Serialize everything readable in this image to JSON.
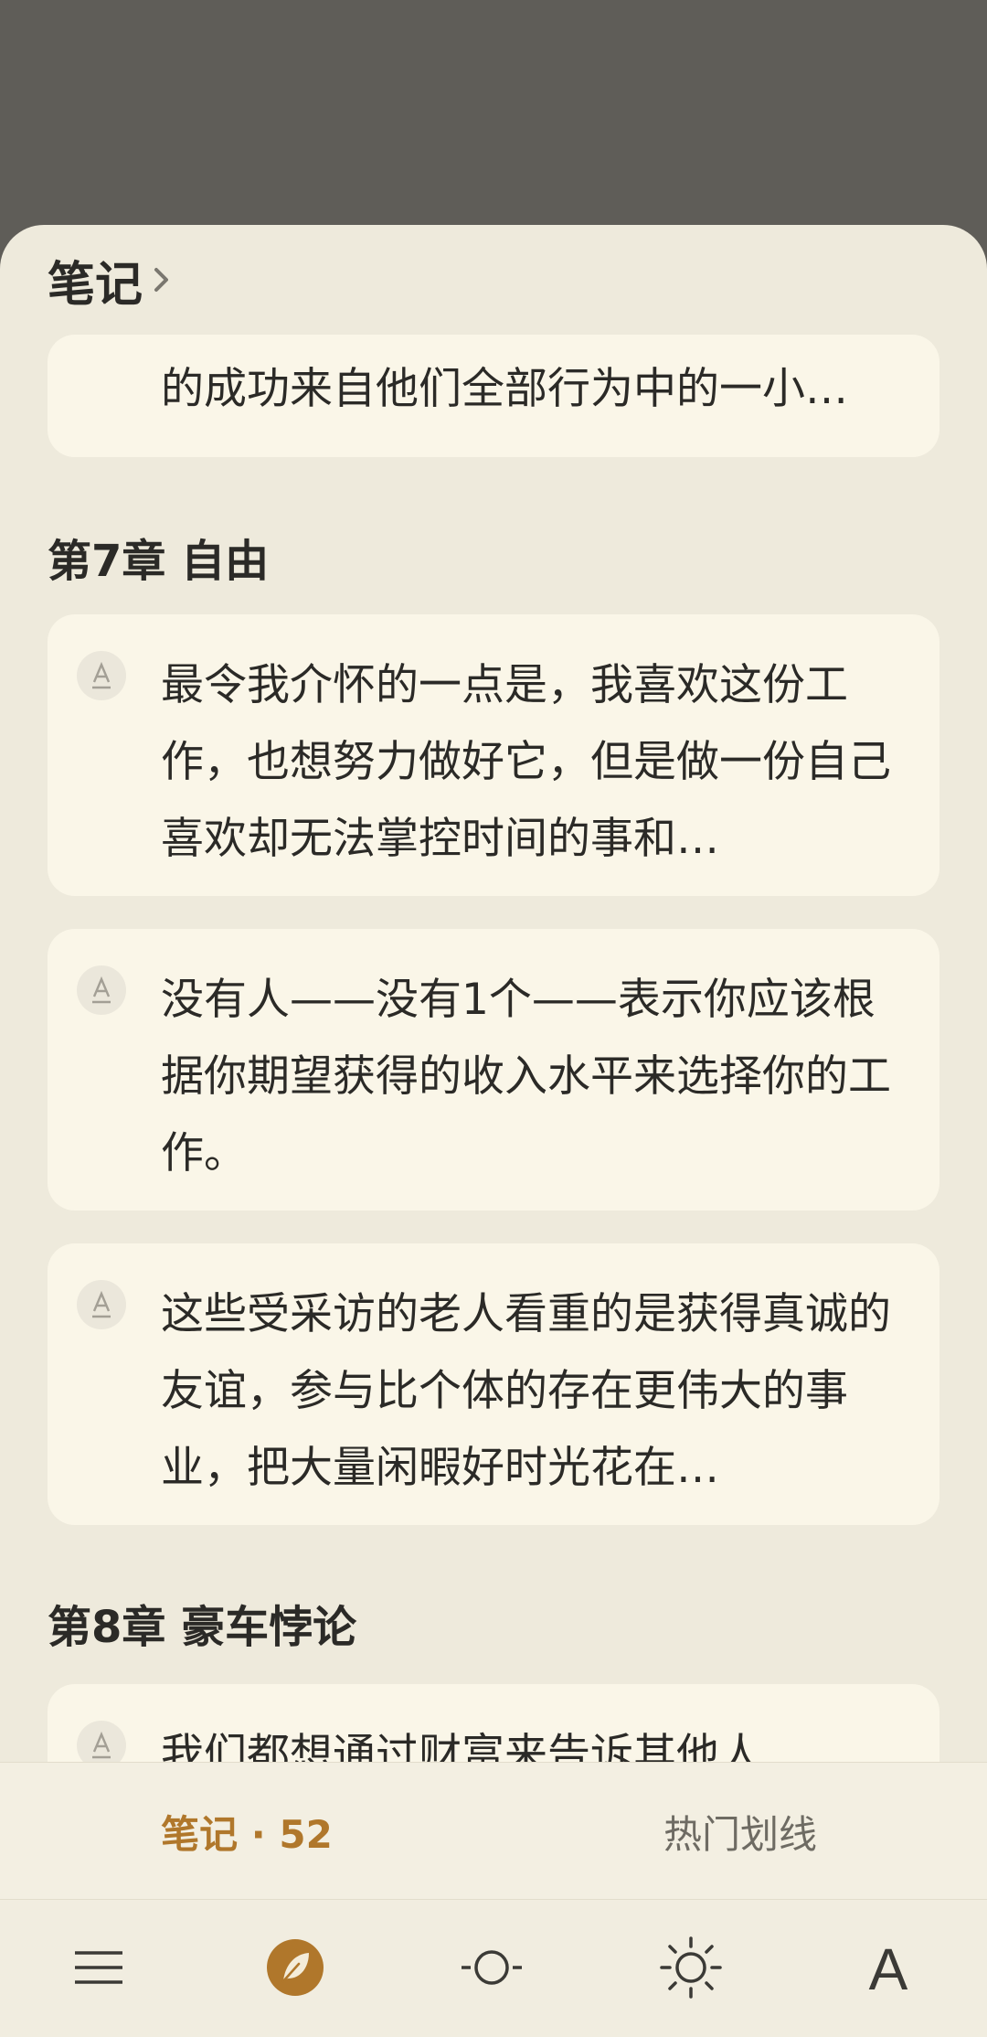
{
  "header": {
    "title": "笔记",
    "chevron_icon": "chevron-right-icon"
  },
  "top_card": {
    "text": "的成功来自他们全部行为中的一小…"
  },
  "chapters": [
    {
      "title": "第7章 自由",
      "notes": [
        {
          "text": "最令我介怀的一点是，我喜欢这份工作，也想努力做好它，但是做一份自己喜欢却无法掌控时间的事和…",
          "icon": "underline-a-icon"
        },
        {
          "text": "没有人——没有1个——表示你应该根据你期望获得的收入水平来选择你的工作。",
          "icon": "underline-a-icon"
        },
        {
          "text": "这些受采访的老人看重的是获得真诚的友谊，参与比个体的存在更伟大的事业，把大量闲暇好时光花在…",
          "icon": "underline-a-icon"
        }
      ]
    },
    {
      "title": "第8章 豪车悖论",
      "notes": [
        {
          "text": "我们都想通过财富来告诉其他人",
          "icon": "underline-a-icon"
        }
      ]
    }
  ],
  "tabs": {
    "notes": "笔记 · 52",
    "hot": "热门划线"
  },
  "toolbar": {
    "menu_icon": "menu-icon",
    "notes_icon": "leaf-icon",
    "progress_icon": "progress-icon",
    "brightness_icon": "brightness-icon",
    "font_label": "A"
  },
  "colors": {
    "accent": "#b0772b",
    "card": "#faf6e8",
    "sheet": "#eeeadc",
    "overlay": "#5f5d58"
  }
}
